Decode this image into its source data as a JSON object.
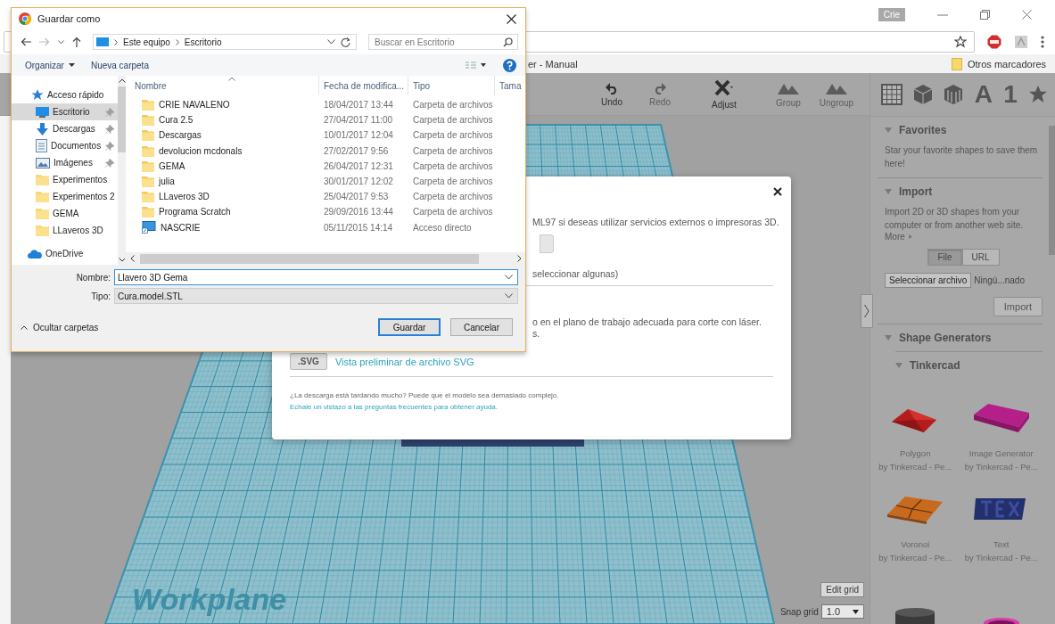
{
  "browser": {
    "profile": "Crie",
    "bookmark": "er - Manual",
    "other_bookmarks": "Otros marcadores"
  },
  "toolbar": {
    "actions": [
      {
        "label": "Undo",
        "kind": "undo",
        "disabled": false
      },
      {
        "label": "Redo",
        "kind": "redo",
        "disabled": true
      },
      {
        "label": "Adjust",
        "kind": "adjust",
        "disabled": false
      },
      {
        "label": "Group",
        "kind": "group",
        "disabled": true
      },
      {
        "label": "Ungroup",
        "kind": "group",
        "disabled": true
      }
    ],
    "tools": [
      {
        "kind": "grid"
      },
      {
        "kind": "cube"
      },
      {
        "kind": "striped"
      },
      {
        "kind": "letter",
        "label": "A"
      },
      {
        "kind": "letter",
        "label": "1"
      },
      {
        "kind": "star"
      }
    ]
  },
  "panel": {
    "favorites": {
      "title": "Favorites",
      "text": "Star your favorite shapes to save them here!"
    },
    "import": {
      "title": "Import",
      "text": "Import 2D or 3D shapes from your computer or from another web site.",
      "more": "More",
      "tabs": [
        {
          "label": "File",
          "selected": true
        },
        {
          "label": "URL",
          "selected": false
        }
      ],
      "choose_button": "Seleccionar archivo",
      "file_status": "Ningú...nado",
      "import_button": "Import"
    },
    "generators": {
      "title": "Shape Generators",
      "group": "Tinkercad",
      "shapes": [
        {
          "kind": "polygon",
          "name": "Polygon",
          "author": "by Tinkercad - Pe..."
        },
        {
          "kind": "slab",
          "name": "Image Generator",
          "author": "by Tinkercad - Pe..."
        },
        {
          "kind": "voronoi",
          "name": "Voronoi",
          "author": "by Tinkercad - Pe..."
        },
        {
          "kind": "text3d",
          "name": "Text",
          "author": "by Tinkercad - Pe..."
        },
        {
          "kind": "cylinder"
        },
        {
          "kind": "ring"
        }
      ]
    }
  },
  "canvas": {
    "workplane_label": "Workplane",
    "edit_grid": "Edit grid",
    "snap_grid_label": "Snap grid",
    "snap_grid_value": "1.0"
  },
  "export_dialog": {
    "services_text": "ML97 si deseas utilizar servicios externos o impresoras 3D.",
    "select_text": "seleccionar algunas)",
    "laser_lines": [
      "o en el plano de trabajo adecuada para corte con láser.",
      "s."
    ],
    "svg_button": ".SVG",
    "svg_link": "Vista preliminar de archivo SVG",
    "note": "¿La descarga está tardando mucho? Puede que el modelo sea demasiado complejo.",
    "help_link": "Echale un vistazo a las preguntas frecuentes para obtener ayuda."
  },
  "save_dialog": {
    "title": "Guardar como",
    "breadcrumb": [
      "Este equipo",
      "Escritorio"
    ],
    "search_placeholder": "Buscar en Escritorio",
    "organize": "Organizar",
    "new_folder": "Nueva carpeta",
    "columns": [
      "Nombre",
      "Fecha de modifica...",
      "Tipo",
      "Tama"
    ],
    "nav": [
      {
        "label": "Acceso rápido",
        "kind": "star",
        "selected": false,
        "children": [
          {
            "label": "Escritorio",
            "kind": "desktop",
            "pinned": true,
            "selected": true
          },
          {
            "label": "Descargas",
            "kind": "download",
            "pinned": true,
            "selected": false
          },
          {
            "label": "Documentos",
            "kind": "documents",
            "pinned": true,
            "selected": false
          },
          {
            "label": "Imágenes",
            "kind": "images",
            "pinned": true,
            "selected": false
          },
          {
            "label": "Experimentos",
            "kind": "folder",
            "pinned": false,
            "selected": false
          },
          {
            "label": "Experimentos 2",
            "kind": "folder",
            "pinned": false,
            "selected": false
          },
          {
            "label": "GEMA",
            "kind": "folder",
            "pinned": false,
            "selected": false
          },
          {
            "label": "LLaveros 3D",
            "kind": "folder",
            "pinned": false,
            "selected": false
          }
        ]
      },
      {
        "label": "OneDrive",
        "kind": "cloud",
        "selected": false
      }
    ],
    "files": [
      {
        "kind": "folder",
        "name": "CRIE NAVALENO",
        "date": "18/04/2017 13:44",
        "type": "Carpeta de archivos"
      },
      {
        "kind": "folder",
        "name": "Cura 2.5",
        "date": "27/04/2017 11:00",
        "type": "Carpeta de archivos"
      },
      {
        "kind": "folder",
        "name": "Descargas",
        "date": "10/01/2017 12:04",
        "type": "Carpeta de archivos"
      },
      {
        "kind": "folder",
        "name": "devolucion mcdonals",
        "date": "27/02/2017 9:56",
        "type": "Carpeta de archivos"
      },
      {
        "kind": "folder",
        "name": "GEMA",
        "date": "26/04/2017 12:31",
        "type": "Carpeta de archivos"
      },
      {
        "kind": "folder",
        "name": "julia",
        "date": "30/01/2017 12:02",
        "type": "Carpeta de archivos"
      },
      {
        "kind": "folder",
        "name": "LLaveros 3D",
        "date": "25/04/2017 9:53",
        "type": "Carpeta de archivos"
      },
      {
        "kind": "folder",
        "name": "Programa Scratch",
        "date": "29/09/2016 13:44",
        "type": "Carpeta de archivos"
      },
      {
        "kind": "shortcut",
        "name": "NASCRIE",
        "date": "05/11/2015 14:14",
        "type": "Acceso directo"
      }
    ],
    "name_label": "Nombre:",
    "name_value": "Llavero 3D Gema",
    "type_label": "Tipo:",
    "type_value": "Cura.model.STL",
    "hide_folders": "Ocultar carpetas",
    "save_button": "Guardar",
    "cancel_button": "Cancelar"
  }
}
